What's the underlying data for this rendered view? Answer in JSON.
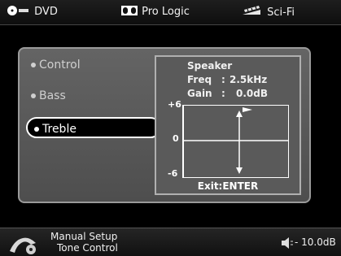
{
  "topbar": {
    "source": "DVD",
    "audio_mode": "Pro Logic",
    "preset": "Sci-Fi"
  },
  "menu": {
    "items": [
      {
        "label": "Control"
      },
      {
        "label": "Bass"
      },
      {
        "label": "Treble",
        "selected": true
      }
    ]
  },
  "info": {
    "title": "Speaker",
    "freq_label": "Freq",
    "freq_value": "2.5kHz",
    "gain_label": "Gain",
    "gain_value": "0.0dB",
    "scale_top": "+6",
    "scale_mid": "0",
    "scale_bottom": "-6",
    "exit_text": "Exit:ENTER"
  },
  "bottombar": {
    "line1": "Manual Setup",
    "line2": "Tone Control",
    "volume": "- 10.0dB"
  },
  "colors": {
    "background": "#000000",
    "panel": "#5a5a5a",
    "selected_bg": "#000000",
    "text": "#ffffff"
  },
  "icons": [
    "disc-icon",
    "dolby-icon",
    "film-icon",
    "setup-icon",
    "speaker-volume-icon"
  ]
}
